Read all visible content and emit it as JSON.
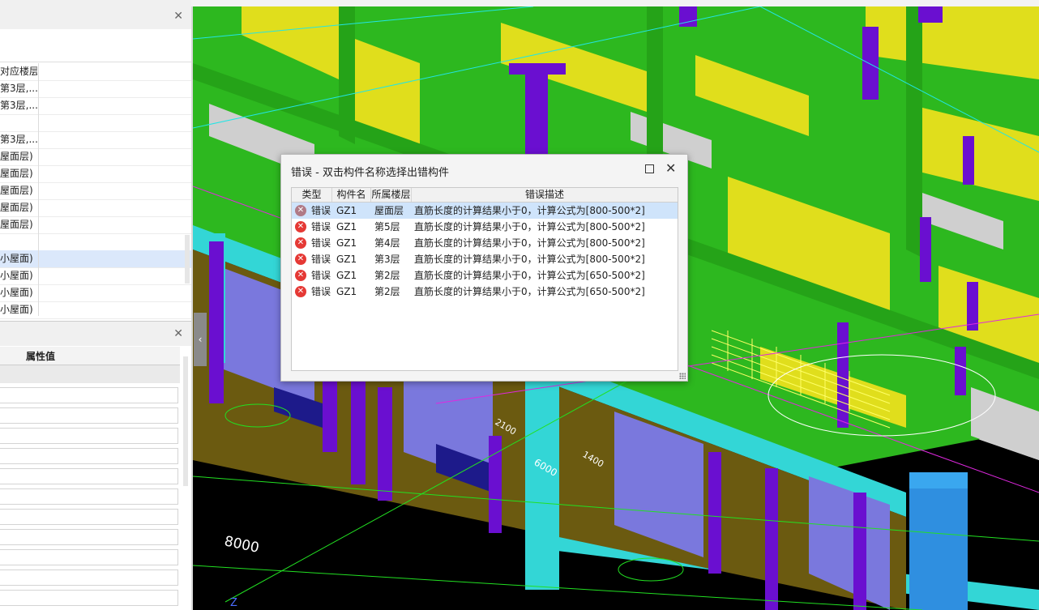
{
  "left_panel": {
    "top_list": {
      "rows": [
        "对应楼层",
        "第3层,...",
        "第3层,...",
        "",
        "第3层,...",
        "屋面层)",
        "屋面层)",
        "屋面层)",
        "屋面层)",
        "屋面层)",
        "",
        "小屋面)",
        "小屋面)",
        "小屋面)",
        "小屋面)"
      ],
      "selected_index": 11
    },
    "prop_panel": {
      "header": "属性值",
      "row_count": 11
    }
  },
  "dialog": {
    "title": "错误 - 双击构件名称选择出错构件",
    "columns": [
      "类型",
      "构件名称",
      "所属楼层",
      "错误描述"
    ],
    "rows": [
      {
        "type": "错误",
        "name": "GZ1",
        "floor": "屋面层",
        "desc": "直筋长度的计算结果小于0，计算公式为[800-500*2]"
      },
      {
        "type": "错误",
        "name": "GZ1",
        "floor": "第5层",
        "desc": "直筋长度的计算结果小于0，计算公式为[800-500*2]"
      },
      {
        "type": "错误",
        "name": "GZ1",
        "floor": "第4层",
        "desc": "直筋长度的计算结果小于0，计算公式为[800-500*2]"
      },
      {
        "type": "错误",
        "name": "GZ1",
        "floor": "第3层",
        "desc": "直筋长度的计算结果小于0，计算公式为[800-500*2]"
      },
      {
        "type": "错误",
        "name": "GZ1",
        "floor": "第2层",
        "desc": "直筋长度的计算结果小于0，计算公式为[650-500*2]"
      },
      {
        "type": "错误",
        "name": "GZ1",
        "floor": "第2层",
        "desc": "直筋长度的计算结果小于0，计算公式为[650-500*2]"
      }
    ],
    "selected_index": 0
  },
  "viewport": {
    "dimension_labels": [
      "8000",
      "6000",
      "2100",
      "1400",
      "Z"
    ],
    "colors": {
      "slab": "#2db81f",
      "wall": "#e0de1c",
      "column": "#6a0fd0",
      "beam": "#33d6d6",
      "brick": "#6b5a10",
      "window": "#7a78dd"
    }
  }
}
